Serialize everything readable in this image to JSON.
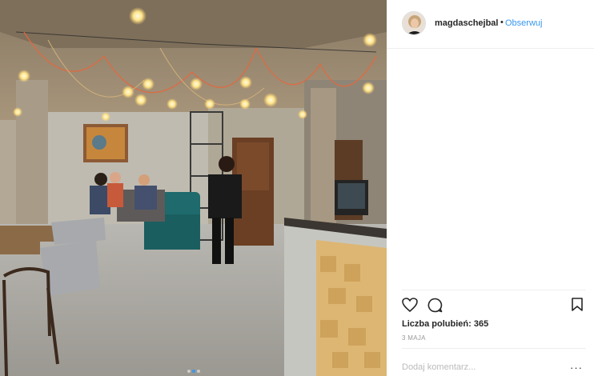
{
  "post": {
    "username": "magdaschejbal",
    "separator": "•",
    "follow_label": "Obserwuj",
    "likes_text": "Liczba polubień: 365",
    "date_text": "3 MAJA",
    "comment_placeholder": "Dodaj komentarz...",
    "more_label": "···"
  },
  "carousel": {
    "dots": 3,
    "active": 2
  },
  "icons": {
    "like": "heart-icon",
    "comment": "comment-bubble-icon",
    "save": "bookmark-icon",
    "more": "more-options-icon"
  },
  "colors": {
    "link_blue": "#3897f0",
    "text": "#262626",
    "muted": "#999999",
    "divider": "#efefef"
  }
}
